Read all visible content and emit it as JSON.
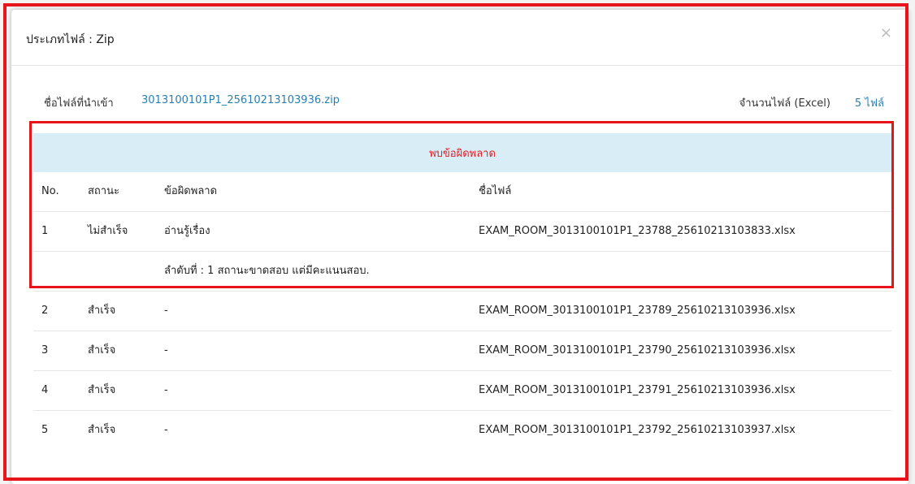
{
  "modal": {
    "title": "ประเภทไฟล์ : Zip",
    "close_label": "×"
  },
  "info": {
    "import_label": "ชื่อไฟล์ที่นำเข้า",
    "import_file": "3013100101P1_25610213103936.zip",
    "count_label": "จำนวนไฟล์ (Excel)",
    "count_value": "5 ไฟล์"
  },
  "error_section": {
    "heading": "พบข้อผิดพลาด",
    "columns": [
      "No.",
      "สถานะ",
      "ข้อผิดพลาด",
      "ชื่อไฟล์"
    ],
    "rows": [
      {
        "no": "1",
        "status": "ไม่สำเร็จ",
        "message": "อ่านรู้เรื่อง",
        "file": "EXAM_ROOM_3013100101P1_23788_25610213103833.xlsx"
      }
    ],
    "detail": "ลำดับที่ : 1 สถานะขาดสอบ แต่มีคะแนนสอบ."
  },
  "other_rows": [
    {
      "no": "2",
      "status": "สำเร็จ",
      "message": "-",
      "file": "EXAM_ROOM_3013100101P1_23789_25610213103936.xlsx"
    },
    {
      "no": "3",
      "status": "สำเร็จ",
      "message": "-",
      "file": "EXAM_ROOM_3013100101P1_23790_25610213103936.xlsx"
    },
    {
      "no": "4",
      "status": "สำเร็จ",
      "message": "-",
      "file": "EXAM_ROOM_3013100101P1_23791_25610213103936.xlsx"
    },
    {
      "no": "5",
      "status": "สำเร็จ",
      "message": "-",
      "file": "EXAM_ROOM_3013100101P1_23792_25610213103937.xlsx"
    }
  ],
  "colors": {
    "accent_link": "#2a7fb0",
    "error_red": "#e41b23",
    "error_header_bg": "#d9edf7",
    "annotation_frame": "#e8141b"
  }
}
